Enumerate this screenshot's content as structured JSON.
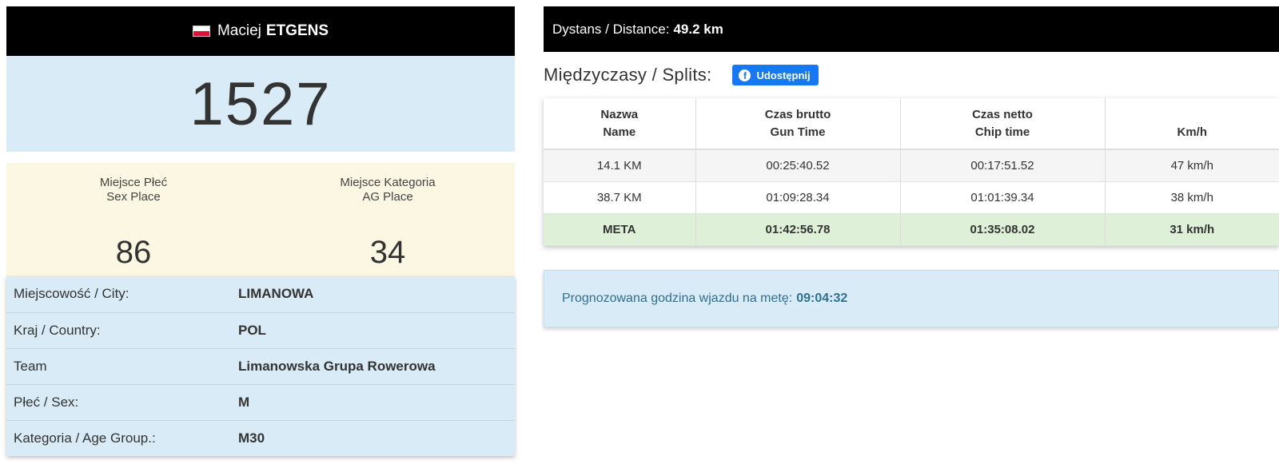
{
  "athlete": {
    "flag_icon": "poland-flag-icon",
    "first_name": "Maciej",
    "last_name": "ETGENS",
    "bib": "1527"
  },
  "places": [
    {
      "label_pl": "Miejsce Płeć",
      "label_en": "Sex Place",
      "value": "86"
    },
    {
      "label_pl": "Miejsce Kategoria",
      "label_en": "AG Place",
      "value": "34"
    }
  ],
  "info": [
    {
      "label": "Miejscowość / City:",
      "value": "LIMANOWA"
    },
    {
      "label": "Kraj / Country:",
      "value": "POL"
    },
    {
      "label": "Team",
      "value": "Limanowska Grupa Rowerowa"
    },
    {
      "label": "Płeć / Sex:",
      "value": "M"
    },
    {
      "label": "Kategoria / Age Group.:",
      "value": "M30"
    }
  ],
  "distance": {
    "label": "Dystans / Distance:",
    "value": "49.2 km"
  },
  "splits": {
    "title": "Międzyczasy / Splits:",
    "share_label": "Udostępnij",
    "share_icon": "facebook-icon",
    "headers": [
      {
        "line1": "Nazwa",
        "line2": "Name"
      },
      {
        "line1": "Czas brutto",
        "line2": "Gun Time"
      },
      {
        "line1": "Czas netto",
        "line2": "Chip time"
      },
      {
        "line1": "",
        "line2": "Km/h"
      }
    ],
    "rows": [
      [
        "14.1 KM",
        "00:25:40.52",
        "00:17:51.52",
        "47 km/h"
      ],
      [
        "38.7 KM",
        "01:09:28.34",
        "01:01:39.34",
        "38 km/h"
      ],
      [
        "META",
        "01:42:56.78",
        "01:35:08.02",
        "31 km/h"
      ]
    ]
  },
  "prediction": {
    "label": "Prognozowana godzina wjazdu na metę:",
    "value": "09:04:32"
  },
  "colors": {
    "header_bg": "#000000",
    "light_blue": "#d8ebf6",
    "light_yellow": "#fcf7e2",
    "finish_green": "#dff0d8",
    "facebook_blue": "#1877f2",
    "info_text": "#31708f"
  }
}
